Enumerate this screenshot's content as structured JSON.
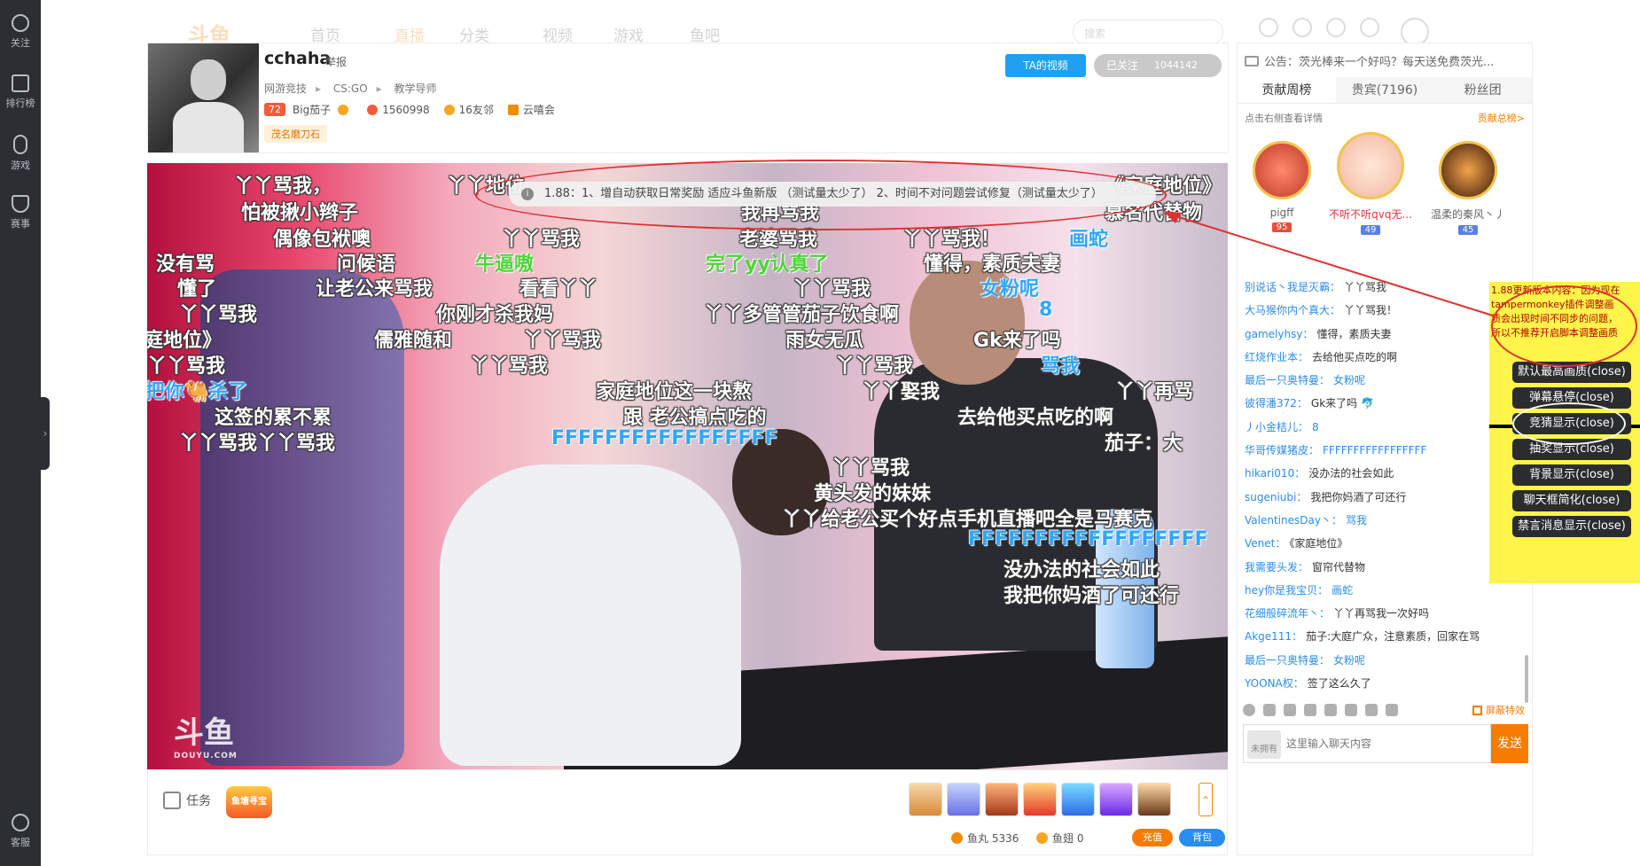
{
  "rail": {
    "items": [
      {
        "label": "关注",
        "icon": "heart-icon"
      },
      {
        "label": "排行榜",
        "icon": "ranking-icon"
      },
      {
        "label": "游戏",
        "icon": "gamepad-icon"
      },
      {
        "label": "赛事",
        "icon": "trophy-icon"
      }
    ],
    "service_label": "客服",
    "expand_glyph": "›"
  },
  "topnav": {
    "logo": "斗鱼",
    "items": [
      "首页",
      "直播",
      "分类",
      "视频",
      "游戏",
      "鱼吧"
    ],
    "search_placeholder": "搜索"
  },
  "anchor": {
    "name": "cchaha",
    "report_label": "举报",
    "breadcrumbs": [
      "网游竞技",
      "CS:GO",
      "教学导师"
    ],
    "level": "72",
    "fan_group": "Big茄子",
    "hot": "1560998",
    "friends": "16友邻",
    "club": "云嘻会",
    "tag": "茂名磨刀石",
    "video_button": "TA的视频",
    "follow_button": "已关注",
    "follow_count": "1044142"
  },
  "video": {
    "notice": "1.88：1、增自动获取日常奖励 适应斗鱼新版 （测试量太少了） 2、时间不对问题尝试修复（测试量太少了）",
    "watermark": "斗鱼",
    "watermark_url": "DOUYU.COM",
    "danmaku": [
      {
        "text": "丫丫骂我，",
        "style": "white"
      },
      {
        "text": "丫丫地位",
        "style": "white"
      },
      {
        "text": "《家庭地位》",
        "style": "white"
      },
      {
        "text": "怕被揪小辫子",
        "style": "white"
      },
      {
        "text": "我再骂我",
        "style": "white"
      },
      {
        "text": "慕名代替物",
        "style": "white"
      },
      {
        "text": "偶像包袱噢",
        "style": "white"
      },
      {
        "text": "丫丫骂我",
        "style": "white"
      },
      {
        "text": "老婆骂我",
        "style": "white"
      },
      {
        "text": "丫丫骂我！",
        "style": "white"
      },
      {
        "text": "画蛇",
        "style": "blue"
      },
      {
        "text": "没有骂",
        "style": "white"
      },
      {
        "text": "问候语",
        "style": "white"
      },
      {
        "text": "牛逼嗷",
        "style": "green"
      },
      {
        "text": "完了yy认真了",
        "style": "green"
      },
      {
        "text": "懂得，素质夫妻",
        "style": "white"
      },
      {
        "text": "懂了",
        "style": "white"
      },
      {
        "text": "让老公来骂我",
        "style": "white"
      },
      {
        "text": "看看丫丫",
        "style": "white"
      },
      {
        "text": "丫丫骂我",
        "style": "white"
      },
      {
        "text": "女粉呢",
        "style": "blue"
      },
      {
        "text": "丫丫骂我",
        "style": "white"
      },
      {
        "text": "你刚才杀我妈",
        "style": "white"
      },
      {
        "text": "丫丫多管管茄子饮食啊",
        "style": "white"
      },
      {
        "text": "8",
        "style": "blue"
      },
      {
        "text": "庭地位》",
        "style": "white"
      },
      {
        "text": "儒雅随和",
        "style": "white"
      },
      {
        "text": "丫丫骂我",
        "style": "white"
      },
      {
        "text": "雨女无瓜",
        "style": "white"
      },
      {
        "text": "Gk来了吗",
        "style": "white"
      },
      {
        "text": "丫丫骂我",
        "style": "white"
      },
      {
        "text": "丫丫骂我",
        "style": "white"
      },
      {
        "text": "丫丫骂我",
        "style": "white"
      },
      {
        "text": "骂我",
        "style": "blue"
      },
      {
        "text": "把你🐫杀了",
        "style": "blue"
      },
      {
        "text": "家庭地位这一块熬",
        "style": "white"
      },
      {
        "text": "丫丫娶我",
        "style": "white"
      },
      {
        "text": "丫丫再骂",
        "style": "white"
      },
      {
        "text": "这签的累不累",
        "style": "white"
      },
      {
        "text": "跟 老公搞点吃的",
        "style": "white"
      },
      {
        "text": "去给他买点吃的啊",
        "style": "white"
      },
      {
        "text": "丫丫骂我丫丫骂我",
        "style": "white"
      },
      {
        "text": "FFFFFFFFFFFFFFFFF",
        "style": "blue"
      },
      {
        "text": "茄子：大",
        "style": "white"
      },
      {
        "text": "丫丫骂我",
        "style": "white"
      },
      {
        "text": "黄头发的妹妹",
        "style": "white"
      },
      {
        "text": "丫丫给老公买个好点手机直播吧全是马赛克",
        "style": "white"
      },
      {
        "text": "FFFFFFFFFFFFFFFFFF",
        "style": "blue"
      },
      {
        "text": "没办法的社会如此",
        "style": "white"
      },
      {
        "text": "我把你妈酒了可还行",
        "style": "white"
      }
    ]
  },
  "bottom": {
    "task_label": "任务",
    "treasure_label": "鱼塘寻宝",
    "fish_balls": "鱼丸 5336",
    "fish_fins": "鱼翅 0",
    "charge_button": "充值",
    "bag_button": "背包",
    "more_glyph": "⌃"
  },
  "side": {
    "announcement": "公告：茨光棒来一个好吗？每天送免费茨光...",
    "tabs": [
      "贡献周榜",
      "贵宾(7196)",
      "粉丝团"
    ],
    "rank_hint": "点击右侧查看详情",
    "rank_total": "贡献总榜>",
    "top3": [
      {
        "name": "pigff",
        "level": "95",
        "lv_color": "red"
      },
      {
        "name": "不听不听qvq无...",
        "level": "49",
        "lv_color": "blue"
      },
      {
        "name": "温柔的秦风丶丿",
        "level": "45",
        "lv_color": "blue"
      }
    ],
    "chat": [
      {
        "user": "别说话丶我是灭霸：",
        "text": "丫丫骂我"
      },
      {
        "user": "大马猴你内个真大：",
        "text": "丫丫骂我！"
      },
      {
        "user": "gamelyhsy：",
        "text": "懂得，素质夫妻"
      },
      {
        "user": "红烧作业本：",
        "text": "去给他买点吃的啊"
      },
      {
        "user": "最后一只奥特曼：",
        "text": "女粉呢",
        "blue": true
      },
      {
        "user": "彼得潘372：",
        "text": "Gk来了吗 🐬"
      },
      {
        "user": "丿小金桔儿：",
        "text": "8",
        "blue": true
      },
      {
        "user": "华哥传媒猪皮：",
        "text": "FFFFFFFFFFFFFFFFF",
        "blue": true
      },
      {
        "user": "hikari010：",
        "text": "没办法的社会如此"
      },
      {
        "user": "sugeniubi：",
        "text": "我把你妈酒了可还行"
      },
      {
        "user": "ValentinesDay丶：",
        "text": "骂我",
        "blue": true
      },
      {
        "user": "Venet：",
        "text": "《家庭地位》"
      },
      {
        "user": "我需要头发：",
        "text": "窗帘代替物"
      },
      {
        "user": "hey你是我宝贝：",
        "text": "画蛇",
        "blue": true
      },
      {
        "user": "花细般碎流年丶：",
        "text": "丫丫再骂我一次好吗"
      },
      {
        "user": "Akge111：",
        "text": "茄子:大庭广众，注意素质，回家在骂"
      },
      {
        "user": "最后一只奥特曼：",
        "text": "女粉呢",
        "blue": true
      },
      {
        "user": "YOONA权：",
        "text": "签了这么久了"
      }
    ],
    "shield_label": "屏蔽特效",
    "badge_label": "未拥有",
    "input_placeholder": "这里输入聊天内容",
    "send_button": "发送"
  },
  "script_panel": {
    "note": "1.88更新版本内容：因为现在tampermonkey插件调整画质会出现时间不同步的问题，所以不推荐开启脚本调整画质",
    "buttons": [
      "默认最高画质(close)",
      "弹幕悬停(close)",
      "竞猜显示(close)",
      "抽奖显示(close)",
      "背景显示(close)",
      "聊天框简化(close)",
      "禁言消息显示(close)"
    ]
  },
  "colors": {
    "accent": "#f57c00",
    "link": "#2a8cef",
    "annotation_red": "#e03030",
    "panel_yellow": "#fff44a",
    "rail_dark": "#2b2e33"
  }
}
